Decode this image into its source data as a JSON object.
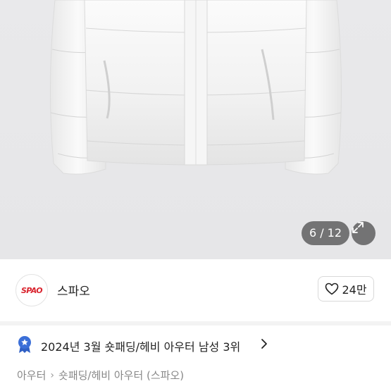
{
  "gallery": {
    "counter": "6 / 12"
  },
  "seller": {
    "logo_text": "SPAO",
    "name": "스파오",
    "like_count": "24만",
    "brand_color": "#d9232d"
  },
  "ranking": {
    "text": "2024년 3월 숏패딩/헤비 아우터 남성 3위",
    "badge_color": "#3b6fd8"
  },
  "breadcrumb": {
    "items": [
      "아우터",
      "숏패딩/헤비 아우터 (스파오)"
    ]
  },
  "icons": {
    "expand": "expand-arrows-icon",
    "heart": "heart-outline-icon",
    "badge": "ribbon-star-icon",
    "chevron": "chevron-right-icon"
  }
}
